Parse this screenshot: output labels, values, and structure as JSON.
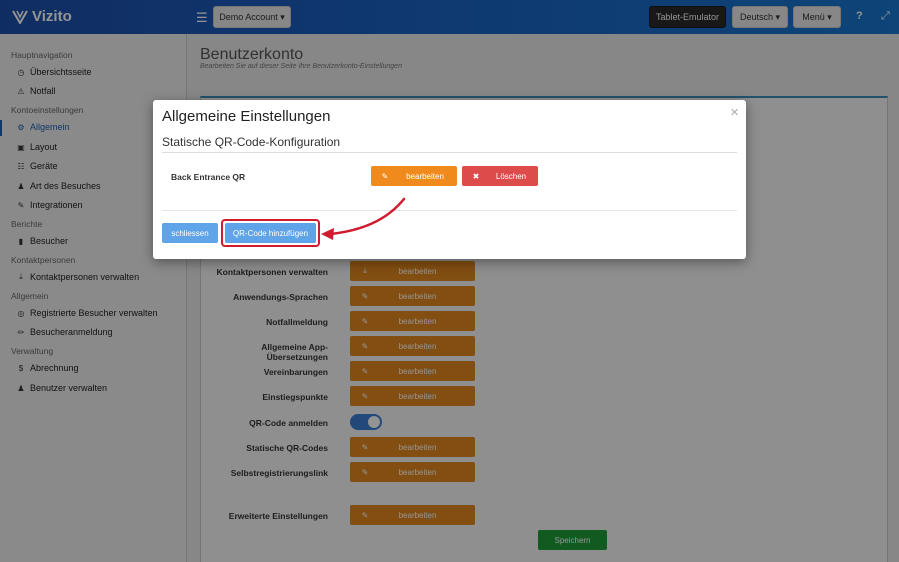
{
  "app": {
    "brand": "Vizito"
  },
  "topbar": {
    "account_dropdown": "Demo Account ▾",
    "tablet_emulator": "Tablet-Emulator",
    "language": "Deutsch ▾",
    "menu": "Menü ▾",
    "help_icon": "?",
    "expand_icon": "⤢"
  },
  "sidebar": {
    "sections": [
      {
        "heading": "Hauptnavigation",
        "items": [
          {
            "label": "Übersichtsseite",
            "icon": "dashboard-icon",
            "glyph": "◷"
          },
          {
            "label": "Notfall",
            "icon": "warning-icon",
            "glyph": "⚠"
          }
        ]
      },
      {
        "heading": "Kontoeinstellungen",
        "items": [
          {
            "label": "Allgemein",
            "icon": "gear-icon",
            "glyph": "⚙",
            "active": true
          },
          {
            "label": "Layout",
            "icon": "image-icon",
            "glyph": "▣"
          },
          {
            "label": "Geräte",
            "icon": "sitemap-icon",
            "glyph": "☷"
          },
          {
            "label": "Art des Besuches",
            "icon": "users-icon",
            "glyph": "♟"
          },
          {
            "label": "Integrationen",
            "icon": "plug-icon",
            "glyph": "✎"
          }
        ]
      },
      {
        "heading": "Berichte",
        "items": [
          {
            "label": "Besucher",
            "icon": "book-icon",
            "glyph": "▮"
          }
        ]
      },
      {
        "heading": "Kontaktpersonen",
        "items": [
          {
            "label": "Kontaktpersonen verwalten",
            "icon": "download-icon",
            "glyph": "⤓"
          }
        ]
      },
      {
        "heading": "Allgemein",
        "items": [
          {
            "label": "Registrierte Besucher verwalten",
            "icon": "globe-icon",
            "glyph": "◎"
          },
          {
            "label": "Besucheranmeldung",
            "icon": "pencil-icon",
            "glyph": "✏"
          }
        ]
      },
      {
        "heading": "Verwaltung",
        "items": [
          {
            "label": "Abrechnung",
            "icon": "dollar-icon",
            "glyph": "$"
          },
          {
            "label": "Benutzer verwalten",
            "icon": "user-plus-icon",
            "glyph": "♟"
          }
        ]
      }
    ]
  },
  "page": {
    "title": "Benutzerkonto",
    "subtitle": "Bearbeiten Sie auf dieser Seite Ihre Benutzerkonto-Einstellungen",
    "rows": [
      {
        "label": "Kontaktpersonen verwalten",
        "button": "bearbeiten",
        "icon": "download-icon",
        "glyph": "⤓"
      },
      {
        "label": "Anwendungs-Sprachen",
        "button": "bearbeiten",
        "icon": "edit-icon",
        "glyph": "✎"
      },
      {
        "label": "Notfallmeldung",
        "button": "bearbeiten",
        "icon": "edit-icon",
        "glyph": "✎"
      },
      {
        "label": "Allgemeine App-Übersetzungen",
        "button": "bearbeiten",
        "icon": "edit-icon",
        "glyph": "✎"
      },
      {
        "label": "Vereinbarungen",
        "button": "bearbeiten",
        "icon": "edit-icon",
        "glyph": "✎"
      },
      {
        "label": "Einstiegspunkte",
        "button": "bearbeiten",
        "icon": "edit-icon",
        "glyph": "✎"
      },
      {
        "label": "QR-Code anmelden",
        "toggle": true
      },
      {
        "label": "Statische QR-Codes",
        "button": "bearbeiten",
        "icon": "edit-icon",
        "glyph": "✎"
      },
      {
        "label": "Selbstregistrierungslink",
        "button": "bearbeiten",
        "icon": "edit-icon",
        "glyph": "✎"
      },
      {
        "label": "Erweiterte Einstellungen",
        "button": "bearbeiten",
        "icon": "edit-icon",
        "glyph": "✎"
      }
    ],
    "save_button": "Speichern"
  },
  "modal": {
    "title": "Allgemeine Einstellungen",
    "close_glyph": "×",
    "subtitle": "Statische QR-Code-Konfiguration",
    "row_label": "Back Entrance QR",
    "edit_button": "bearbeiten",
    "edit_glyph": "✎",
    "delete_button": "Löschen",
    "delete_glyph": "✖",
    "close_button": "schliessen",
    "add_button": "QR-Code hinzufügen"
  },
  "colors": {
    "accent": "#1a5fb4",
    "edit": "#e0871e",
    "delete": "#dd4b4b",
    "primary_button": "#5fa3e8",
    "save": "#1e9e3a",
    "highlight": "#d01c2e"
  }
}
